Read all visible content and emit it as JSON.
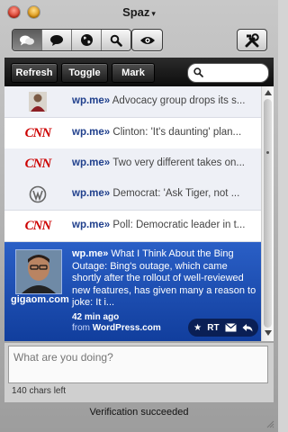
{
  "window": {
    "title": "Spaz",
    "title_caret": "▾"
  },
  "toolbar": {
    "tabs": [
      {
        "name": "friends-tab",
        "icon": "chat-bubbles-icon",
        "active": true
      },
      {
        "name": "replies-tab",
        "icon": "speech-bubble-icon",
        "active": false
      },
      {
        "name": "public-tab",
        "icon": "globe-icon",
        "active": false
      },
      {
        "name": "search-tab",
        "icon": "magnifier-icon",
        "active": false
      }
    ],
    "eye_icon": "eye-icon",
    "tools_icon": "tools-icon"
  },
  "actions": {
    "refresh": "Refresh",
    "toggle": "Toggle",
    "mark": "Mark",
    "search_placeholder": ""
  },
  "timeline": {
    "rows": [
      {
        "avatar": "person-avatar",
        "source": "wp.me»",
        "text": "Advocacy group drops its s..."
      },
      {
        "avatar": "cnn-logo",
        "avatar_text": "CNN",
        "source": "wp.me»",
        "text": "Clinton: 'It's daunting' plan..."
      },
      {
        "avatar": "cnn-logo",
        "avatar_text": "CNN",
        "source": "wp.me»",
        "text": "Two very different takes on..."
      },
      {
        "avatar": "wordpress-logo",
        "source": "wp.me»",
        "text": "Democrat: 'Ask Tiger, not ..."
      },
      {
        "avatar": "cnn-logo",
        "avatar_text": "CNN",
        "source": "wp.me»",
        "text": "Poll: Democratic leader in t..."
      }
    ],
    "selected": {
      "avatar_caption": "gigaom.com",
      "source": "wp.me»",
      "text": "What I Think About the Bing Outage: Bing's outage, which came shortly after the rollout of well-reviewed new features, has given many a reason to joke: It i...",
      "time": "42 min ago",
      "from_label": "from",
      "from_app": "WordPress.com",
      "rt_label": "RT"
    }
  },
  "compose": {
    "placeholder": "What are you doing?",
    "chars_left": "140 chars left"
  },
  "status": {
    "message": "Verification succeeded"
  },
  "colors": {
    "selected_bg": "#1f50b5",
    "link": "#1f3f8c",
    "cnn_red": "#cc0000"
  }
}
